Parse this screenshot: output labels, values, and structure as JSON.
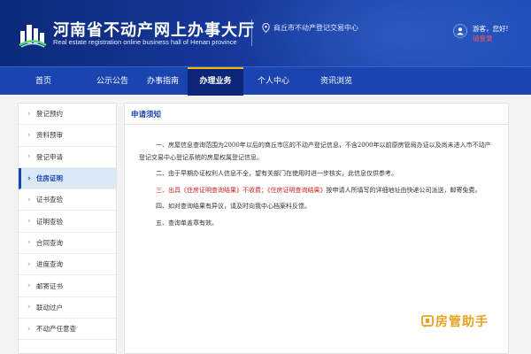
{
  "header": {
    "title_cn": "河南省不动产网上办事大厅",
    "title_en": "Real estate registration online business hall of Henan province",
    "location": "商丘市不动产登记交易中心",
    "greeting": "游客，您好!",
    "login_label": "请登录"
  },
  "nav": {
    "items": [
      {
        "label": "首页"
      },
      {
        "label": "公示公告"
      },
      {
        "label": "办事指南"
      },
      {
        "label": "办理业务"
      },
      {
        "label": "个人中心"
      },
      {
        "label": "资讯浏览"
      }
    ],
    "active_index": 3
  },
  "sidebar": {
    "items": [
      {
        "label": "登记预约"
      },
      {
        "label": "资料预审"
      },
      {
        "label": "登记申请"
      },
      {
        "label": "住房证明"
      },
      {
        "label": "证书查验"
      },
      {
        "label": "证明查验"
      },
      {
        "label": "合同查询"
      },
      {
        "label": "进度查询"
      },
      {
        "label": "邮寄证书"
      },
      {
        "label": "联动过户"
      },
      {
        "label": "不动产任意查"
      }
    ],
    "active_index": 3
  },
  "main": {
    "title": "申请须知",
    "para1": "一、房屋信息查询范围为2000年以后的商丘市区的不动产登记信息，不含2000年以前原房管局办证以及尚未进入市不动产登记交易中心登记系统的房屋权属登记信息。",
    "para2": "二、由于早期办证权利人信息不全，望有关部门在使用时进一步核实，此信息仅供参考。",
    "para3_red": "三、出具《住房证明查询结果》不收费；《住房证明查询结果》",
    "para3_rest": "按申请人所填写的详细地址由快递公司派送，邮寄免费。",
    "para4": "四、如对查询结果有异议，请及时向我中心档案科反馈。",
    "para5": "五、查询单盖章有效。"
  },
  "watermark": {
    "text": "房管助手"
  },
  "colors": {
    "header_dark": "#0c2a7a",
    "nav_blue": "#1a45b0",
    "nav_active": "#0c2577",
    "accent_yellow": "#ffb400",
    "sidebar_active_bg": "#dbe9f7",
    "red_text": "#d22222",
    "watermark_orange": "#e8a020"
  }
}
